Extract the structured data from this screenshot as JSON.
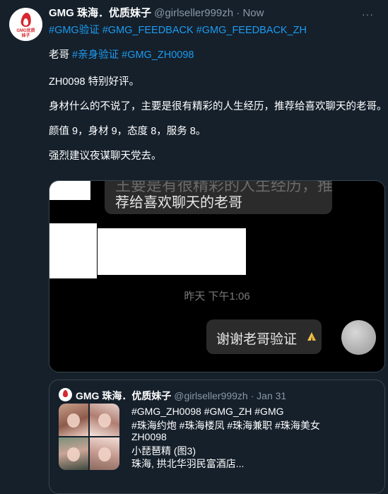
{
  "tweet": {
    "avatar_text": "GMG优质\n妹子",
    "name": "GMG 珠海．优质妹子",
    "handle": "@girlseller999zh",
    "sep": "·",
    "time": "Now",
    "more_label": "···",
    "hashtags": "#GMG验证 #GMG_FEEDBACK #GMG_FEEDBACK_ZH",
    "line1_prefix": "老哥 ",
    "line1_links": "#亲身验证 #GMG_ZH0098",
    "line2": "ZH0098 特别好评。",
    "line3": "身材什么的不说了，主要是很有精彩的人生经历，推荐给喜欢聊天的老哥。",
    "line4": "颜值 9，身材 9，态度 8，服务 8。",
    "line5": "强烈建议夜谋聊天党去。"
  },
  "media": {
    "bubble_cut_text": "王要是有很精彩的人生经历，推",
    "bubble_text": "荐给喜欢聊天的老哥",
    "timestamp": "昨天 下午1:06",
    "reply_text": "谢谢老哥验证",
    "pray_icon": "pray-emoji-icon"
  },
  "quote": {
    "name": "GMG 珠海．优质妹子",
    "handle": "@girlseller999zh",
    "sep": "·",
    "time": "Jan 31",
    "line1": "#GMG_ZH0098 #GMG_ZH #GMG",
    "line2": "#珠海约炮 #珠海楼凤 #珠海兼职 #珠海美女",
    "line3": "ZH0098",
    "line4": "小琵琶精 (图3)",
    "line5": "珠海, 拱北华羽民富酒店..."
  },
  "colors": {
    "background": "#15202b",
    "link": "#1d9bf0",
    "muted": "#8b98a5",
    "border": "#38444d"
  }
}
